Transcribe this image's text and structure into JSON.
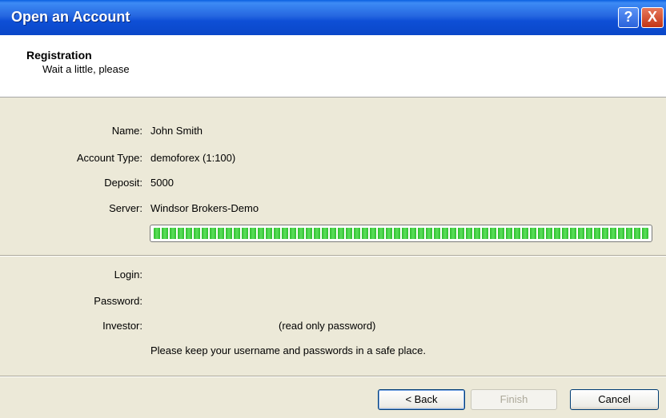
{
  "window": {
    "title": "Open an Account",
    "help_label": "?",
    "close_label": "X"
  },
  "header": {
    "title": "Registration",
    "subtitle": "Wait a little, please"
  },
  "details": {
    "name_label": "Name:",
    "name_value": "John Smith",
    "account_type_label": "Account Type:",
    "account_type_value": "demoforex (1:100)",
    "deposit_label": "Deposit:",
    "deposit_value": "5000",
    "server_label": "Server:",
    "server_value": "Windsor Brokers-Demo"
  },
  "progress": {
    "value": 1.0
  },
  "credentials": {
    "login_label": "Login:",
    "password_label": "Password:",
    "investor_label": "Investor:",
    "investor_note": "(read only password)",
    "notice": "Please keep your username and passwords in a safe place."
  },
  "buttons": {
    "back": "< Back",
    "finish": "Finish",
    "cancel": "Cancel"
  },
  "colors": {
    "title_bar": "#0A47C8",
    "dialog_bg": "#ECE9D8",
    "progress": "#2EBE2E"
  }
}
